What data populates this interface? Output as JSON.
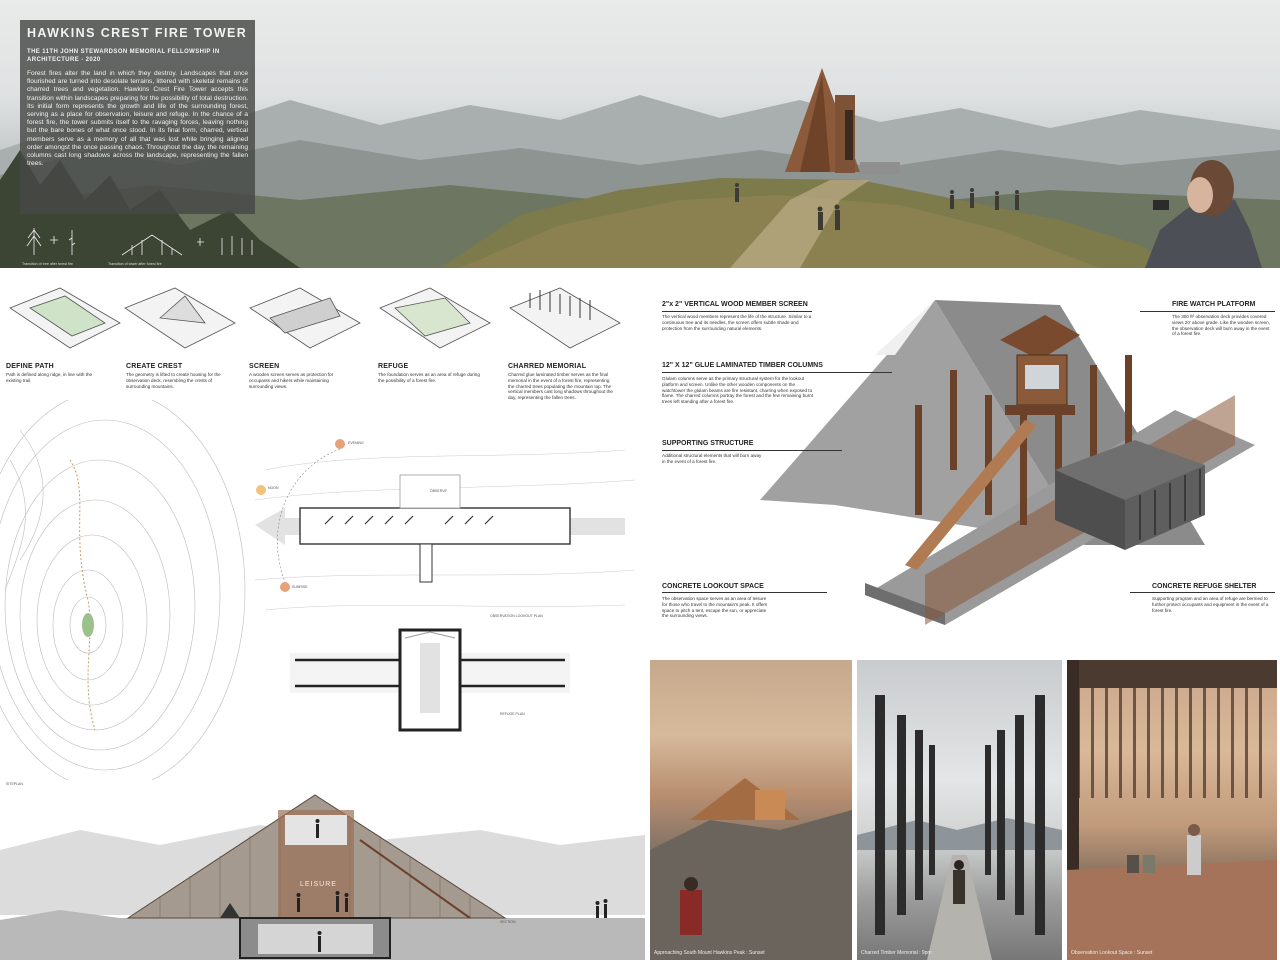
{
  "title": "HAWKINS CREST FIRE TOWER",
  "subtitle": "THE 11TH JOHN STEWARDSON MEMORIAL FELLOWSHIP IN ARCHITECTURE - 2020",
  "intro": "Forest fires alter the land in which they destroy. Landscapes that once flourished are turned into desolate terrains, littered with skeletal remains of charred trees and vegetation. Hawkins Crest Fire Tower accepts this transition within landscapes preparing for the possibility of total destruction. Its initial form represents the growth and life of the surrounding forest, serving as a place for observation, leisure and refuge. In the chance of a forest fire, the tower submits itself to the ravaging forces, leaving nothing but the bare bones of what once stood. In its final form, charred, vertical members serve as a memory of all that was lost while bringing aligned order amongst the once passing chaos. Throughout the day, the remaining columns cast long shadows across the landscape, representing the fallen trees.",
  "sketch_captions": [
    "Transition of tree after forest fire",
    "Transition of tower after forest fire"
  ],
  "diagrams": [
    {
      "title": "DEFINE PATH",
      "text": "Path is defined along ridge, in line with the existing trail."
    },
    {
      "title": "CREATE CREST",
      "text": "The geometry is lifted to create housing for the observation deck, resembling the crests of surrounding mountains."
    },
    {
      "title": "SCREEN",
      "text": "A wooden screen serves as protection for occupants and hikers while maintaining surrounding views."
    },
    {
      "title": "REFUGE",
      "text": "The foundation serves as an area of refuge during the possibility of a forest fire."
    },
    {
      "title": "CHARRED MEMORIAL",
      "text": "Charred glue laminated timber serves as the final memorial in the event of a forest fire, representing the charred trees populating the mountain top. The vertical members cast long shadows throughout the day, representing the fallen trees."
    }
  ],
  "axon": {
    "screen": {
      "title": "2\"x 2\" VERTICAL WOOD MEMBER SCREEN",
      "text": "The vertical wood members represent the life of the structure. Similar to a continuous tree and its needles, the screen offers subtle shade and protection from the surrounding natural elements."
    },
    "columns": {
      "title": "12\" X 12\" GLUE LAMINATED TIMBER COLUMNS",
      "text": "Glulam columns serve as the primary structural system for the lookout platform and screen. Unlike the other wooden components on the watchtower the glulam beams are fire resistant, charring when exposed to flame. The charred columns portray the forest and the few remaining burnt trees left standing after a forest fire."
    },
    "support": {
      "title": "SUPPORTING STRUCTURE",
      "text": "Additional structural elements that will burn away in the event of a forest fire."
    },
    "lookout": {
      "title": "CONCRETE LOOKOUT SPACE",
      "text": "The observation space serves as an area of leisure for those who travel to the mountain's peak. It offers space to pitch a tent, escape the sun, or appreciate the surrounding views."
    },
    "platform": {
      "title": "FIRE WATCH PLATFORM",
      "text": "The 300 ft² observation deck provides covered views 20' above grade. Like the wooden screen, the observation deck will burn away in the event of a forest fire."
    },
    "shelter": {
      "title": "CONCRETE REFUGE SHELTER",
      "text": "Supporting program and an area of refuge are bermed to further protect occupants and equipment in the event of a forest fire."
    }
  },
  "plan_labels": {
    "sun": [
      "SUNRISE",
      "NOON",
      "EVENING"
    ],
    "observe": "OBSERVE",
    "lookout_plan": "OBSERVATION LOOKOUT PLAN",
    "refuge_plan": "REFUGE PLAN",
    "site_plan": "SITEPLAN",
    "section": "SECTION",
    "leisure": "LEISURE",
    "refuge": "REFUGE",
    "deck": "DECK"
  },
  "renders": [
    {
      "caption": "Approaching South Mount Hawkins Peak : Sunset"
    },
    {
      "caption": "Charred Timber Memorial : 9pm"
    },
    {
      "caption": "Observation Lookout Space : Sunset"
    }
  ],
  "colors": {
    "wood": "#8a5a3a",
    "concrete": "#8c8c8c",
    "panel": "#4a4b49",
    "sun": "#e8a27a"
  }
}
